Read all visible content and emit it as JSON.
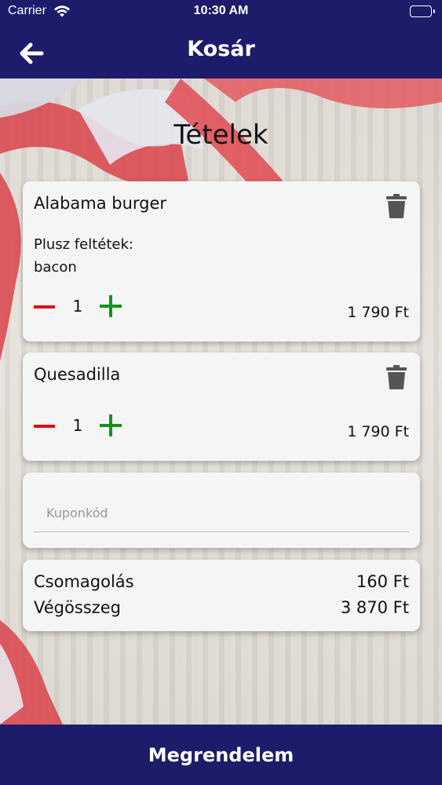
{
  "status_bar": {
    "carrier": "Carrier",
    "time": "10:30 AM"
  },
  "nav": {
    "title": "Kosár",
    "back_icon": "arrow-left-icon"
  },
  "section_title": "Tételek",
  "items": [
    {
      "name": "Alabama burger",
      "extras_label": "Plusz feltétek:",
      "extras": "bacon",
      "quantity": "1",
      "price": "1 790 Ft"
    },
    {
      "name": "Quesadilla",
      "quantity": "1",
      "price": "1 790 Ft"
    }
  ],
  "coupon": {
    "placeholder": "Kuponkód",
    "value": ""
  },
  "summary": {
    "packaging_label": "Csomagolás",
    "packaging_value": "160 Ft",
    "total_label": "Végösszeg",
    "total_value": "3 870 Ft"
  },
  "order_button": "Megrendelem",
  "colors": {
    "primary": "#1c1c6b",
    "minus": "#e01010",
    "plus": "#12941a",
    "card": "#f5f5f5"
  }
}
